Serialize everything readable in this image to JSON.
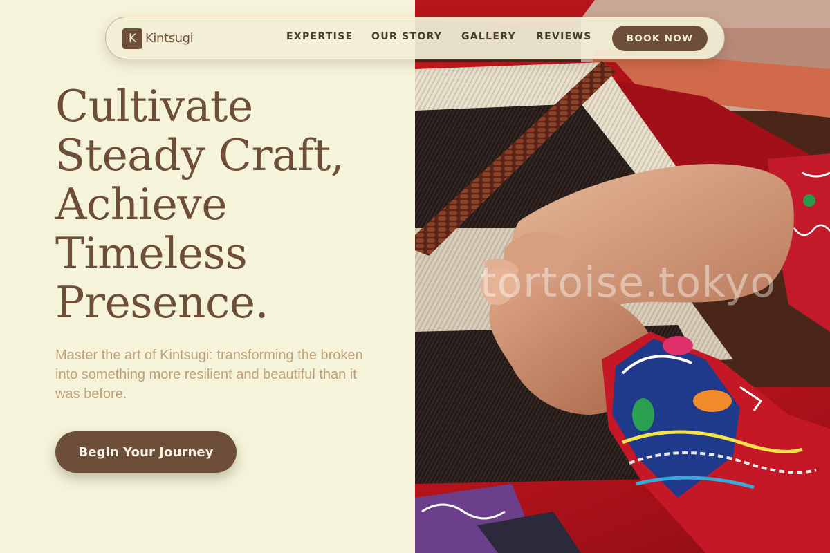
{
  "nav": {
    "brand_letter": "K",
    "brand_name": "Kintsugi",
    "links": [
      {
        "label": "EXPERTISE"
      },
      {
        "label": "OUR STORY"
      },
      {
        "label": "GALLERY"
      },
      {
        "label": "REVIEWS"
      }
    ],
    "cta_label": "BOOK NOW"
  },
  "hero": {
    "heading_lines": [
      "Cultivate",
      "Steady Craft,",
      "Achieve",
      "Timeless",
      "Presence."
    ],
    "subtext": "Master the art of Kintsugi: transforming the broken into something more resilient and beautiful than it was before.",
    "cta_label": "Begin Your Journey"
  },
  "photo": {
    "watermark": "tortoise.tokyo"
  },
  "colors": {
    "background": "#f5f4da",
    "brand_brown": "#6d4e38",
    "subtext_tan": "#c0a07a",
    "loom_red": "#b8141c"
  }
}
